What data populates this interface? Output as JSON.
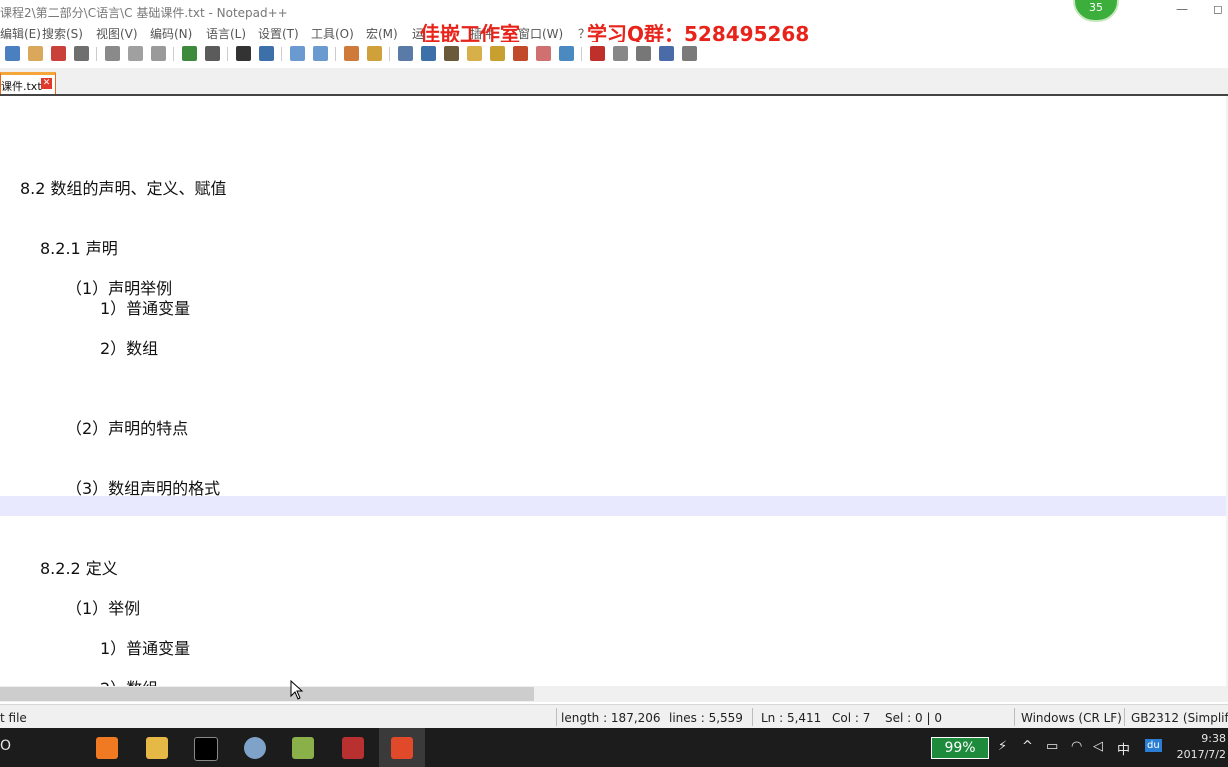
{
  "window": {
    "title": "课程2\\第二部分\\C语言\\C 基础课件.txt - Notepad++",
    "minimize_glyph": "—",
    "restore_glyph": "◻"
  },
  "watermark": {
    "studio": "佳嵌工作室",
    "qq": "学习Q群：528495268"
  },
  "badge": {
    "count": "35"
  },
  "menu": [
    "编辑(E)",
    "搜索(S)",
    "视图(V)",
    "编码(N)",
    "语言(L)",
    "设置(T)",
    "工具(O)",
    "宏(M)",
    "运",
    "插件",
    "窗口(W)",
    "？"
  ],
  "tab": {
    "label": "课件.txt",
    "close_glyph": "✕"
  },
  "editor": {
    "lines": [
      "8.2 数组的声明、定义、赋值",
      "8.2.1 声明",
      "（1）声明举例",
      "1）普通变量",
      "2）数组",
      "（2）声明的特点",
      "（3）数组声明的格式",
      "8.2.2 定义",
      "（1）举例",
      "1）普通变量",
      "2）数组"
    ]
  },
  "status": {
    "type": "t file",
    "length": "length : 187,206",
    "lines": "lines : 5,559",
    "ln": "Ln : 5,411",
    "col": "Col : 7",
    "sel": "Sel : 0 | 0",
    "eol": "Windows (CR LF)",
    "encoding": "GB2312 (Simplifie"
  },
  "taskbar": {
    "start_glyph": "O",
    "battery": "99%",
    "ime": "中",
    "baidu": "du",
    "time": "9:38",
    "date": "2017/7/2"
  },
  "colors": {
    "accent": "#e8231a",
    "tab_border": "#f6a53a",
    "current_line": "#e8e8ff",
    "battery_bg": "#1d8a3c"
  }
}
